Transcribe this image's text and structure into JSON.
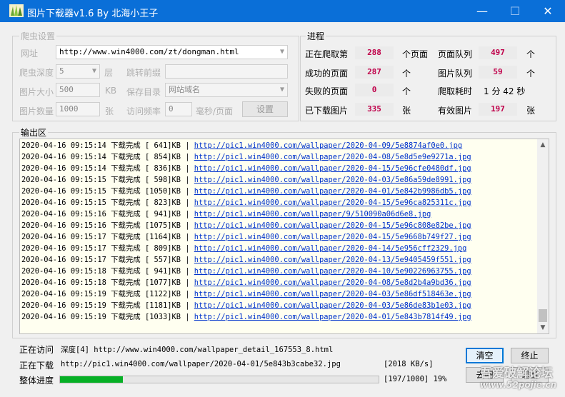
{
  "window": {
    "title": "图片下载器v1.6 By 北海小王子",
    "minimize": "—",
    "maximize": "☐",
    "close": "✕"
  },
  "settings": {
    "group_label": "爬虫设置",
    "url_label": "网址",
    "url_value": "http://www.win4000.com/zt/dongman.html",
    "depth_label": "爬虫深度",
    "depth_value": "5",
    "layer_label": "层",
    "jump_prefix_label": "跳转前缀",
    "jump_prefix_value": "",
    "size_label": "图片大小",
    "size_value": "500",
    "size_unit": "KB",
    "save_dir_label": "保存目录",
    "save_dir_value": "网站域名",
    "count_label": "图片数量",
    "count_value": "1000",
    "count_unit": "张",
    "freq_label": "访问频率",
    "freq_value": "0",
    "freq_unit": "毫秒/页面",
    "settings_button": "设置"
  },
  "progress": {
    "group_label": "进程",
    "crawling_label": "正在爬取第",
    "crawling_value": "288",
    "crawling_unit": "个页面",
    "page_queue_label": "页面队列",
    "page_queue_value": "497",
    "page_queue_unit": "个",
    "success_label": "成功的页面",
    "success_value": "287",
    "success_unit": "个",
    "image_queue_label": "图片队列",
    "image_queue_value": "59",
    "image_queue_unit": "个",
    "failed_label": "失败的页面",
    "failed_value": "0",
    "failed_unit": "个",
    "elapsed_label": "爬取耗时",
    "elapsed_value": "1 分 42 秒",
    "downloaded_label": "已下载图片",
    "downloaded_value": "335",
    "downloaded_unit": "张",
    "valid_label": "有效图片",
    "valid_value": "197",
    "valid_unit": "张"
  },
  "output": {
    "label": "输出区",
    "lines": [
      {
        "ts": "2020-04-16 09:15:14",
        "status": "下载完成",
        "size": "[ 641]KB",
        "url": "http://pic1.win4000.com/wallpaper/2020-04-09/5e8874af0e0.jpg"
      },
      {
        "ts": "2020-04-16 09:15:14",
        "status": "下载完成",
        "size": "[ 854]KB",
        "url": "http://pic1.win4000.com/wallpaper/2020-04-08/5e8d5e9e9271a.jpg"
      },
      {
        "ts": "2020-04-16 09:15:14",
        "status": "下载完成",
        "size": "[ 836]KB",
        "url": "http://pic1.win4000.com/wallpaper/2020-04-15/5e96cfe0480df.jpg"
      },
      {
        "ts": "2020-04-16 09:15:15",
        "status": "下载完成",
        "size": "[ 598]KB",
        "url": "http://pic1.win4000.com/wallpaper/2020-04-03/5e86a59de8991.jpg"
      },
      {
        "ts": "2020-04-16 09:15:15",
        "status": "下载完成",
        "size": "[1050]KB",
        "url": "http://pic1.win4000.com/wallpaper/2020-04-01/5e842b9986db5.jpg"
      },
      {
        "ts": "2020-04-16 09:15:15",
        "status": "下载完成",
        "size": "[ 823]KB",
        "url": "http://pic1.win4000.com/wallpaper/2020-04-15/5e96ca825311c.jpg"
      },
      {
        "ts": "2020-04-16 09:15:16",
        "status": "下载完成",
        "size": "[ 941]KB",
        "url": "http://pic1.win4000.com/wallpaper/9/510090a06d6e8.jpg"
      },
      {
        "ts": "2020-04-16 09:15:16",
        "status": "下载完成",
        "size": "[1075]KB",
        "url": "http://pic1.win4000.com/wallpaper/2020-04-15/5e96c808e82be.jpg"
      },
      {
        "ts": "2020-04-16 09:15:17",
        "status": "下载完成",
        "size": "[1164]KB",
        "url": "http://pic1.win4000.com/wallpaper/2020-04-15/5e9668b749f27.jpg"
      },
      {
        "ts": "2020-04-16 09:15:17",
        "status": "下载完成",
        "size": "[ 809]KB",
        "url": "http://pic1.win4000.com/wallpaper/2020-04-14/5e956cff2329.jpg"
      },
      {
        "ts": "2020-04-16 09:15:17",
        "status": "下载完成",
        "size": "[ 557]KB",
        "url": "http://pic1.win4000.com/wallpaper/2020-04-13/5e9405459f551.jpg"
      },
      {
        "ts": "2020-04-16 09:15:18",
        "status": "下载完成",
        "size": "[ 941]KB",
        "url": "http://pic1.win4000.com/wallpaper/2020-04-10/5e90226963755.jpg"
      },
      {
        "ts": "2020-04-16 09:15:18",
        "status": "下载完成",
        "size": "[1077]KB",
        "url": "http://pic1.win4000.com/wallpaper/2020-04-08/5e8d2b4a9bd36.jpg"
      },
      {
        "ts": "2020-04-16 09:15:19",
        "status": "下载完成",
        "size": "[1122]KB",
        "url": "http://pic1.win4000.com/wallpaper/2020-04-03/5e86df518463e.jpg"
      },
      {
        "ts": "2020-04-16 09:15:19",
        "status": "下载完成",
        "size": "[1181]KB",
        "url": "http://pic1.win4000.com/wallpaper/2020-04-03/5e86de83b1e03.jpg"
      },
      {
        "ts": "2020-04-16 09:15:19",
        "status": "下载完成",
        "size": "[1033]KB",
        "url": "http://pic1.win4000.com/wallpaper/2020-04-01/5e843b7814f49.jpg"
      }
    ]
  },
  "status": {
    "visiting_label": "正在访问",
    "visiting_value": "深度[4] http://www.win4000.com/wallpaper_detail_167553_8.html",
    "downloading_label": "正在下载",
    "downloading_value": "http://pic1.win4000.com/wallpaper/2020-04-01/5e843b3cabe32.jpg",
    "speed": "[2018 KB/s]",
    "overall_label": "整体进度",
    "overall_text": "[197/1000] 19%",
    "overall_fraction": 0.197,
    "clear_button": "清空",
    "stop_button": "终止",
    "back_button": "去吧",
    "exit_button": "退出"
  },
  "watermark": {
    "text": "吾爱破解论坛",
    "url": "www.52pojie.cn"
  },
  "colors": {
    "title_bar": "#0a6fd8",
    "stat_value": "#c0004a",
    "link": "#0033cc",
    "progress": "#06b025",
    "log_background": "#fffff0"
  }
}
